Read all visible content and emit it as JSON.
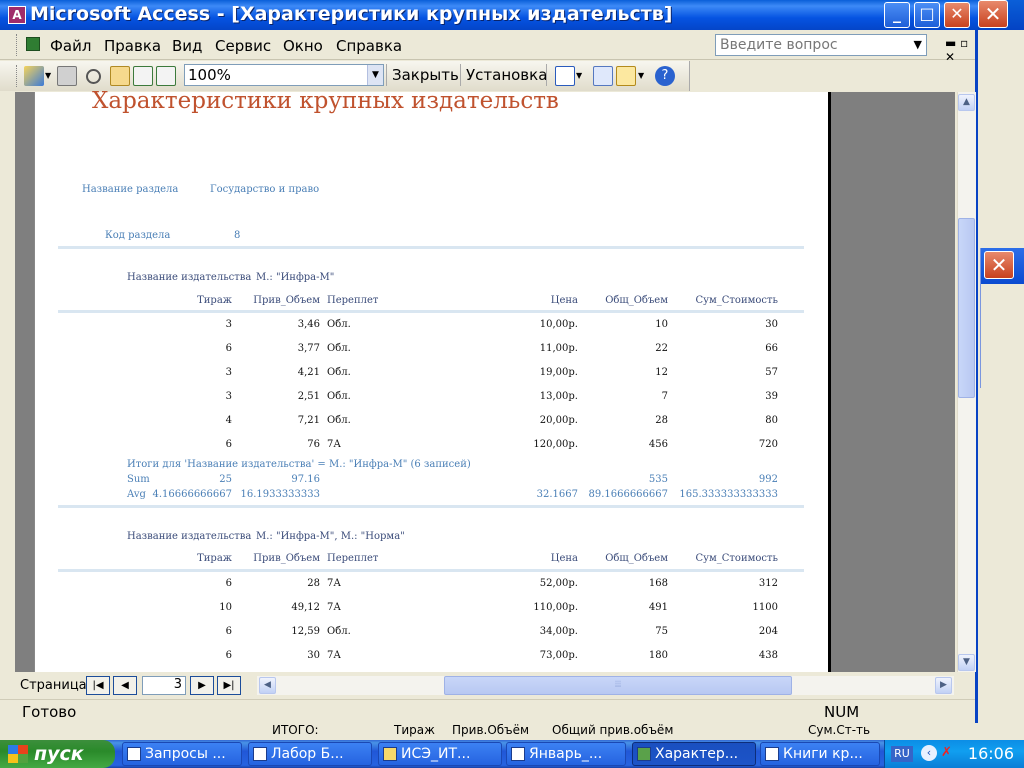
{
  "window": {
    "title": "Microsoft Access - [Характеристики крупных издательств]"
  },
  "menu": {
    "items": [
      "Файл",
      "Правка",
      "Вид",
      "Сервис",
      "Окно",
      "Справка"
    ],
    "ask_placeholder": "Введите вопрос"
  },
  "toolbar": {
    "zoom": "100%",
    "close_label": "Закрыть",
    "setup_label": "Установка"
  },
  "report": {
    "title": "Характеристики крупных издательств",
    "section_name_label": "Название раздела",
    "section_name_value": "Государство и право",
    "section_code_label": "Код раздела",
    "section_code_value": "8",
    "groups": [
      {
        "publisher_label": "Название издательства",
        "publisher_value": "М.: \"Инфра-М\"",
        "columns": [
          "Тираж",
          "Прив_Объем",
          "Переплет",
          "Цена",
          "Общ_Объем",
          "Сум_Стоимость"
        ],
        "rows": [
          [
            "3",
            "3,46",
            "Обл.",
            "10,00р.",
            "10",
            "30"
          ],
          [
            "6",
            "3,77",
            "Обл.",
            "11,00р.",
            "22",
            "66"
          ],
          [
            "3",
            "4,21",
            "Обл.",
            "19,00р.",
            "12",
            "57"
          ],
          [
            "3",
            "2,51",
            "Обл.",
            "13,00р.",
            "7",
            "39"
          ],
          [
            "4",
            "7,21",
            "Обл.",
            "20,00р.",
            "28",
            "80"
          ],
          [
            "6",
            "76",
            "7А",
            "120,00р.",
            "456",
            "720"
          ]
        ],
        "totals_caption": "Итоги для 'Название издательства' =  М.: \"Инфра-М\" (6 записей)",
        "sum_label": "Sum",
        "sum_values": [
          "25",
          "97.16",
          "535",
          "992"
        ],
        "avg_label": "Avg",
        "avg_values": [
          "4.16666666667",
          "16.1933333333",
          "32.1667",
          "89.1666666667",
          "165.333333333333"
        ]
      },
      {
        "publisher_label": "Название издательства",
        "publisher_value": "М.: \"Инфра-М\", М.: \"Норма\"",
        "columns": [
          "Тираж",
          "Прив_Объем",
          "Переплет",
          "Цена",
          "Общ_Объем",
          "Сум_Стоимость"
        ],
        "rows": [
          [
            "6",
            "28",
            "7А",
            "52,00р.",
            "168",
            "312"
          ],
          [
            "10",
            "49,12",
            "7А",
            "110,00р.",
            "491",
            "1100"
          ],
          [
            "6",
            "12,59",
            "Обл.",
            "34,00р.",
            "75",
            "204"
          ],
          [
            "6",
            "30",
            "7А",
            "73,00р.",
            "180",
            "438"
          ]
        ]
      }
    ]
  },
  "nav": {
    "page_label": "Страница:",
    "page_number": "3"
  },
  "status": {
    "ready": "Готово",
    "num": "NUM"
  },
  "underlying": {
    "cells": [
      "ИТОГО:",
      "Тираж",
      "Прив.Объём",
      "Общий прив.объём",
      "Сум.Ст-ть"
    ]
  },
  "taskbar": {
    "start": "пуск",
    "tasks": [
      "Запросы ...",
      "Лабор Б...",
      "ИСЭ_ИТ...",
      "Январь_...",
      "Характер...",
      "Книги кр..."
    ],
    "lang": "RU",
    "clock": "16:06"
  }
}
